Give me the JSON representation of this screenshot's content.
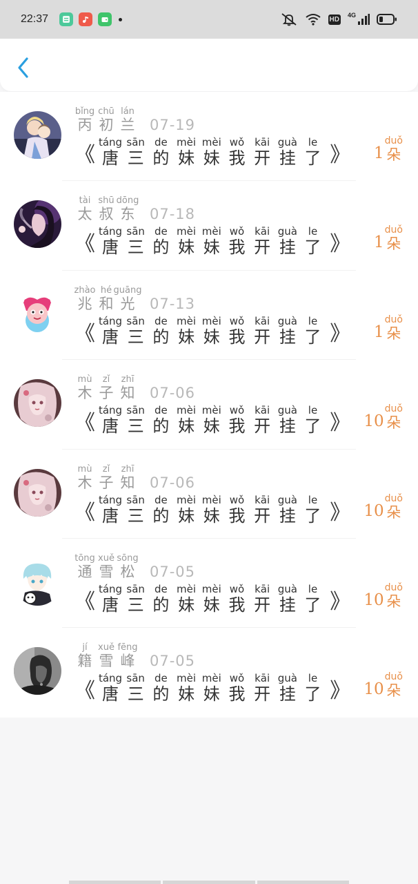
{
  "status_bar": {
    "time": "22:37",
    "notification_apps": [
      {
        "icon": "notes-app-icon",
        "color": "#4cc99a"
      },
      {
        "icon": "music-app-icon",
        "color": "#ef5a4a"
      },
      {
        "icon": "wallet-app-icon",
        "color": "#3fc46a"
      }
    ],
    "hd_label": "HD",
    "network_label": "4G"
  },
  "header": {
    "back_icon": "chevron-left-icon",
    "accent_color": "#2a9fe0"
  },
  "gifts": [
    {
      "avatar": "avatar-anime-couple",
      "name": [
        {
          "py": "bǐng",
          "hz": "丙"
        },
        {
          "py": "chū",
          "hz": "初"
        },
        {
          "py": "lán",
          "hz": "兰"
        }
      ],
      "date": "07-19",
      "title": [
        {
          "py": "táng",
          "hz": "唐"
        },
        {
          "py": "sān",
          "hz": "三"
        },
        {
          "py": "de",
          "hz": "的"
        },
        {
          "py": "mèi",
          "hz": "妹"
        },
        {
          "py": "mèi",
          "hz": "妹"
        },
        {
          "py": "wǒ",
          "hz": "我"
        },
        {
          "py": "kāi",
          "hz": "开"
        },
        {
          "py": "guà",
          "hz": "挂"
        },
        {
          "py": "le",
          "hz": "了"
        }
      ],
      "count": "1",
      "unit": {
        "py": "duǒ",
        "hz": "朵"
      }
    },
    {
      "avatar": "avatar-smoking-woman",
      "name": [
        {
          "py": "tài",
          "hz": "太"
        },
        {
          "py": "shū",
          "hz": "叔"
        },
        {
          "py": "dōng",
          "hz": "东"
        }
      ],
      "date": "07-18",
      "title": [
        {
          "py": "táng",
          "hz": "唐"
        },
        {
          "py": "sān",
          "hz": "三"
        },
        {
          "py": "de",
          "hz": "的"
        },
        {
          "py": "mèi",
          "hz": "妹"
        },
        {
          "py": "mèi",
          "hz": "妹"
        },
        {
          "py": "wǒ",
          "hz": "我"
        },
        {
          "py": "kāi",
          "hz": "开"
        },
        {
          "py": "guà",
          "hz": "挂"
        },
        {
          "py": "le",
          "hz": "了"
        }
      ],
      "count": "1",
      "unit": {
        "py": "duǒ",
        "hz": "朵"
      }
    },
    {
      "avatar": "avatar-pink-cartoon",
      "name": [
        {
          "py": "zhào",
          "hz": "兆"
        },
        {
          "py": "hé",
          "hz": "和"
        },
        {
          "py": "guāng",
          "hz": "光"
        }
      ],
      "date": "07-13",
      "title": [
        {
          "py": "táng",
          "hz": "唐"
        },
        {
          "py": "sān",
          "hz": "三"
        },
        {
          "py": "de",
          "hz": "的"
        },
        {
          "py": "mèi",
          "hz": "妹"
        },
        {
          "py": "mèi",
          "hz": "妹"
        },
        {
          "py": "wǒ",
          "hz": "我"
        },
        {
          "py": "kāi",
          "hz": "开"
        },
        {
          "py": "guà",
          "hz": "挂"
        },
        {
          "py": "le",
          "hz": "了"
        }
      ],
      "count": "1",
      "unit": {
        "py": "duǒ",
        "hz": "朵"
      }
    },
    {
      "avatar": "avatar-pink-hair-girl",
      "name": [
        {
          "py": "mù",
          "hz": "木"
        },
        {
          "py": "zǐ",
          "hz": "子"
        },
        {
          "py": "zhī",
          "hz": "知"
        }
      ],
      "date": "07-06",
      "title": [
        {
          "py": "táng",
          "hz": "唐"
        },
        {
          "py": "sān",
          "hz": "三"
        },
        {
          "py": "de",
          "hz": "的"
        },
        {
          "py": "mèi",
          "hz": "妹"
        },
        {
          "py": "mèi",
          "hz": "妹"
        },
        {
          "py": "wǒ",
          "hz": "我"
        },
        {
          "py": "kāi",
          "hz": "开"
        },
        {
          "py": "guà",
          "hz": "挂"
        },
        {
          "py": "le",
          "hz": "了"
        }
      ],
      "count": "10",
      "unit": {
        "py": "duǒ",
        "hz": "朵"
      }
    },
    {
      "avatar": "avatar-pink-hair-girl",
      "name": [
        {
          "py": "mù",
          "hz": "木"
        },
        {
          "py": "zǐ",
          "hz": "子"
        },
        {
          "py": "zhī",
          "hz": "知"
        }
      ],
      "date": "07-06",
      "title": [
        {
          "py": "táng",
          "hz": "唐"
        },
        {
          "py": "sān",
          "hz": "三"
        },
        {
          "py": "de",
          "hz": "的"
        },
        {
          "py": "mèi",
          "hz": "妹"
        },
        {
          "py": "mèi",
          "hz": "妹"
        },
        {
          "py": "wǒ",
          "hz": "我"
        },
        {
          "py": "kāi",
          "hz": "开"
        },
        {
          "py": "guà",
          "hz": "挂"
        },
        {
          "py": "le",
          "hz": "了"
        }
      ],
      "count": "10",
      "unit": {
        "py": "duǒ",
        "hz": "朵"
      }
    },
    {
      "avatar": "avatar-anime-boy-cat",
      "name": [
        {
          "py": "tōng",
          "hz": "通"
        },
        {
          "py": "xuě",
          "hz": "雪"
        },
        {
          "py": "sōng",
          "hz": "松"
        }
      ],
      "date": "07-05",
      "title": [
        {
          "py": "táng",
          "hz": "唐"
        },
        {
          "py": "sān",
          "hz": "三"
        },
        {
          "py": "de",
          "hz": "的"
        },
        {
          "py": "mèi",
          "hz": "妹"
        },
        {
          "py": "mèi",
          "hz": "妹"
        },
        {
          "py": "wǒ",
          "hz": "我"
        },
        {
          "py": "kāi",
          "hz": "开"
        },
        {
          "py": "guà",
          "hz": "挂"
        },
        {
          "py": "le",
          "hz": "了"
        }
      ],
      "count": "10",
      "unit": {
        "py": "duǒ",
        "hz": "朵"
      }
    },
    {
      "avatar": "avatar-dark-portrait",
      "name": [
        {
          "py": "jí",
          "hz": "籍"
        },
        {
          "py": "xuě",
          "hz": "雪"
        },
        {
          "py": "fēng",
          "hz": "峰"
        }
      ],
      "date": "07-05",
      "title": [
        {
          "py": "táng",
          "hz": "唐"
        },
        {
          "py": "sān",
          "hz": "三"
        },
        {
          "py": "de",
          "hz": "的"
        },
        {
          "py": "mèi",
          "hz": "妹"
        },
        {
          "py": "mèi",
          "hz": "妹"
        },
        {
          "py": "wǒ",
          "hz": "我"
        },
        {
          "py": "kāi",
          "hz": "开"
        },
        {
          "py": "guà",
          "hz": "挂"
        },
        {
          "py": "le",
          "hz": "了"
        }
      ],
      "count": "10",
      "unit": {
        "py": "duǒ",
        "hz": "朵"
      }
    }
  ],
  "brackets": {
    "open": "《",
    "close": "》"
  },
  "colors": {
    "flower_accent": "#e8904a",
    "name_gray": "#9a9a9a",
    "title_dark": "#333333"
  }
}
